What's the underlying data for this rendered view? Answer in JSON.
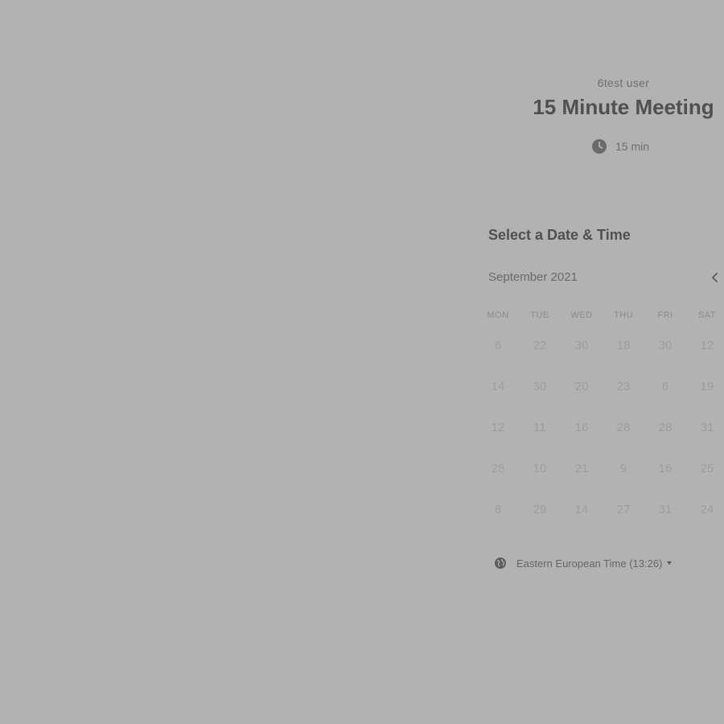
{
  "event": {
    "organizer": "6test user",
    "title": "15 Minute Meeting",
    "duration": "15 min"
  },
  "scheduler": {
    "heading": "Select a Date & Time",
    "month": "September 2021",
    "weekdays": [
      "MON",
      "TUE",
      "WED",
      "THU",
      "FRI",
      "SAT"
    ],
    "weeks": [
      [
        "6",
        "22",
        "30",
        "18",
        "30",
        "12"
      ],
      [
        "14",
        "30",
        "20",
        "23",
        "6",
        "19"
      ],
      [
        "12",
        "11",
        "16",
        "28",
        "28",
        "31"
      ],
      [
        "28",
        "10",
        "21",
        "9",
        "16",
        "25"
      ],
      [
        "8",
        "29",
        "14",
        "27",
        "31",
        "24"
      ]
    ],
    "timezone": "Eastern European Time (13:26)"
  },
  "icons": {
    "clock": "clock-icon",
    "globe": "globe-icon",
    "prev": "chevron-left-icon",
    "caret": "caret-down-icon"
  },
  "colors": {
    "overlay_background": "#b2b2b2",
    "title_text": "#505050",
    "secondary_text": "#6f6f6f",
    "day_text": "#9d9d9d"
  }
}
